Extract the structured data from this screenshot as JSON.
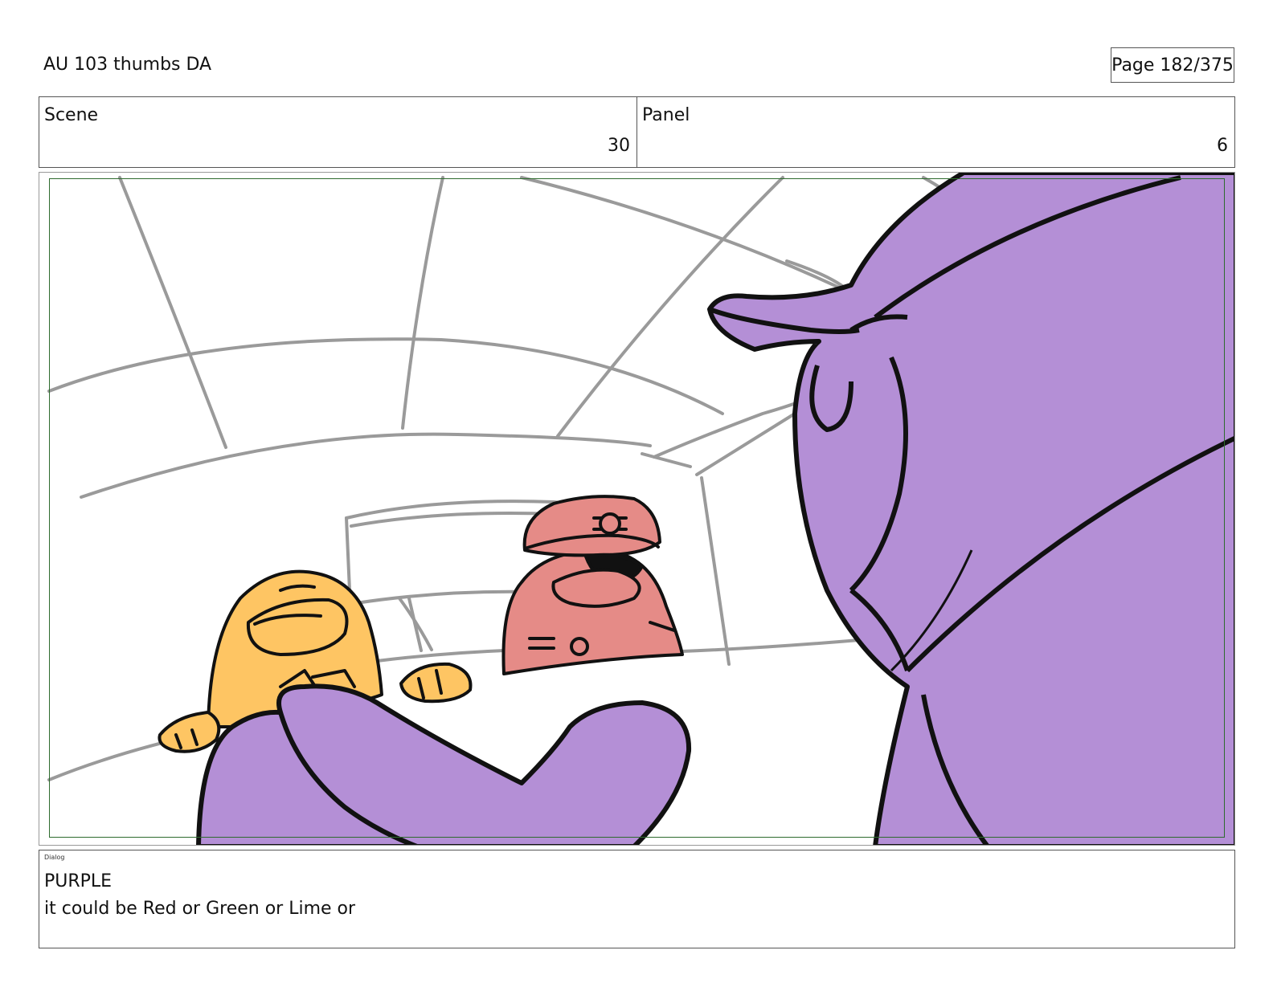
{
  "header": {
    "title": "AU 103 thumbs DA",
    "page": "Page 182/375"
  },
  "meta": {
    "scene_label": "Scene",
    "scene_value": "30",
    "panel_label": "Panel",
    "panel_value": "6"
  },
  "panel": {
    "illustration": "storyboard-drawing",
    "colors": {
      "purple": "#b48fd6",
      "yellow": "#fec563",
      "red": "#e58b87",
      "sketch": "#9a9a9a",
      "ink": "#111111",
      "safe_frame": "#2e6b2e"
    }
  },
  "dialog": {
    "label": "Dialog",
    "speaker": "PURPLE",
    "line": "it could be Red or Green or Lime or"
  }
}
